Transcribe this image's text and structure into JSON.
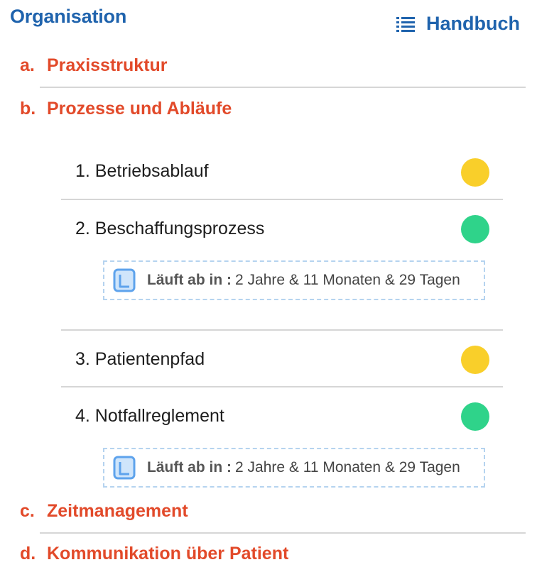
{
  "header": {
    "title": "Organisation",
    "handbook_label": "Handbuch",
    "accent_color": "#1f63ad"
  },
  "sections": [
    {
      "letter": "a.",
      "label": "Praxisstruktur"
    },
    {
      "letter": "b.",
      "label": "Prozesse und Abläufe"
    },
    {
      "letter": "c.",
      "label": "Zeitmanagement"
    },
    {
      "letter": "d.",
      "label": "Kommunikation über Patient"
    }
  ],
  "section_color": "#e24a2a",
  "processes": [
    {
      "label": "1. Betriebsablauf",
      "status": "yellow"
    },
    {
      "label": "2. Beschaffungsprozess",
      "status": "green",
      "expiry_label": "Läuft ab in :",
      "expiry_value": "2 Jahre & 11 Monaten & 29 Tagen"
    },
    {
      "label": "3. Patientenpfad",
      "status": "yellow"
    },
    {
      "label": "4. Notfallreglement",
      "status": "green",
      "expiry_label": "Läuft ab in :",
      "expiry_value": "2 Jahre & 11 Monaten & 29 Tagen"
    }
  ],
  "status_colors": {
    "yellow": "#f9cf2a",
    "green": "#2fd38a"
  },
  "icons": {
    "handbook": "list-icon",
    "expiry": "calendar-icon"
  }
}
